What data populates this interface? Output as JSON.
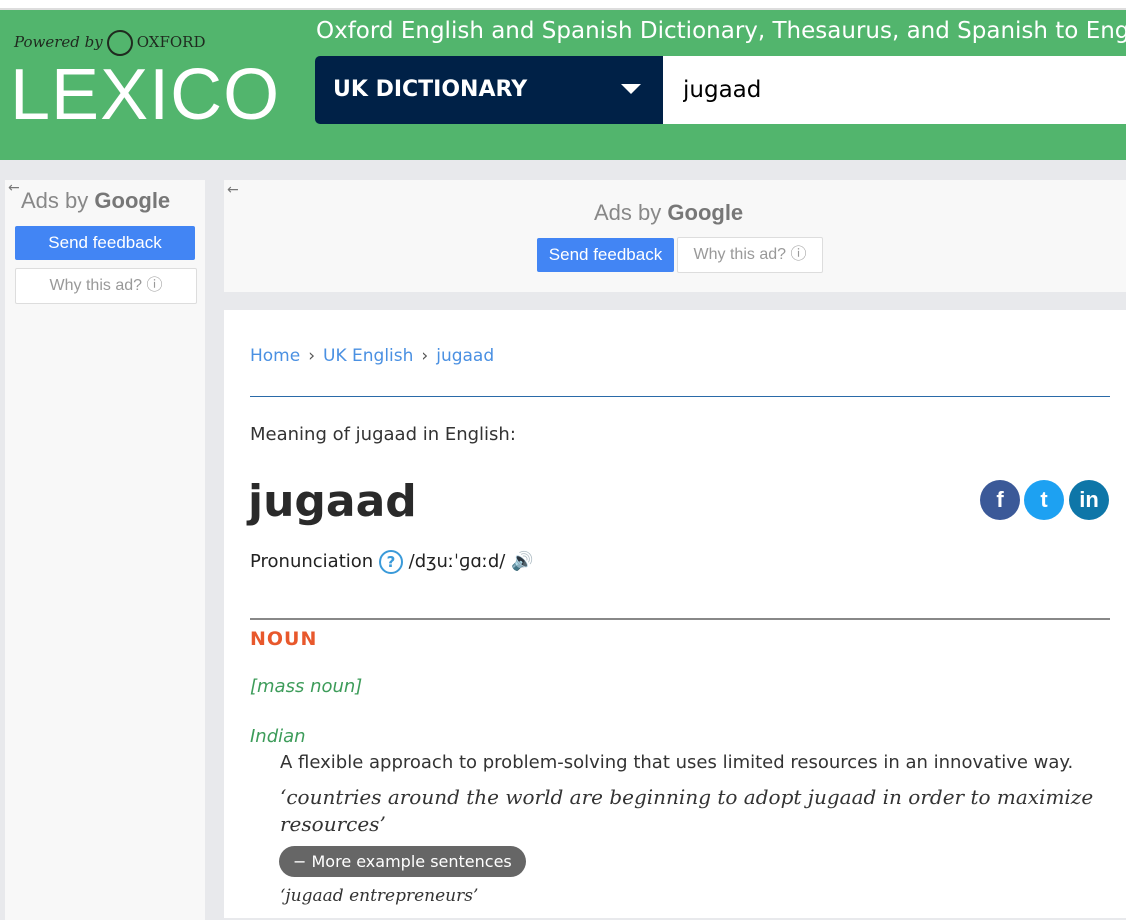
{
  "header": {
    "powered_by": "Powered by",
    "oxford": "OXFORD",
    "logo": "LEXICO",
    "tagline": "Oxford English and Spanish Dictionary, Thesaurus, and Spanish to English",
    "dictionary_select": "UK DICTIONARY",
    "search_value": "jugaad",
    "brand_color": "#52b56d"
  },
  "ads": {
    "ads_by": "Ads by",
    "google": "Google",
    "send_feedback": "Send feedback",
    "why_this_ad": "Why this ad? ⓘ",
    "back_arrow": "←"
  },
  "breadcrumb": [
    {
      "label": "Home"
    },
    {
      "label": "UK English"
    },
    {
      "label": "jugaad"
    }
  ],
  "breadcrumb_sep": "›",
  "entry": {
    "meaning_of": "Meaning of jugaad in English:",
    "headword": "jugaad",
    "pronunciation_label": "Pronunciation",
    "help": "?",
    "ipa": "/dʒuːˈɡɑːd/",
    "speaker": "🔊",
    "pos": "NOUN",
    "grammar": "[mass noun]",
    "region": "Indian",
    "definition": "A flexible approach to problem-solving that uses limited resources in an innovative way.",
    "example": "‘countries around the world are beginning to adopt jugaad in order to maximize resources’",
    "more_examples": "− More example sentences",
    "example2": "‘jugaad entrepreneurs’"
  },
  "social": {
    "facebook": "f",
    "twitter": "t",
    "linkedin": "in"
  }
}
